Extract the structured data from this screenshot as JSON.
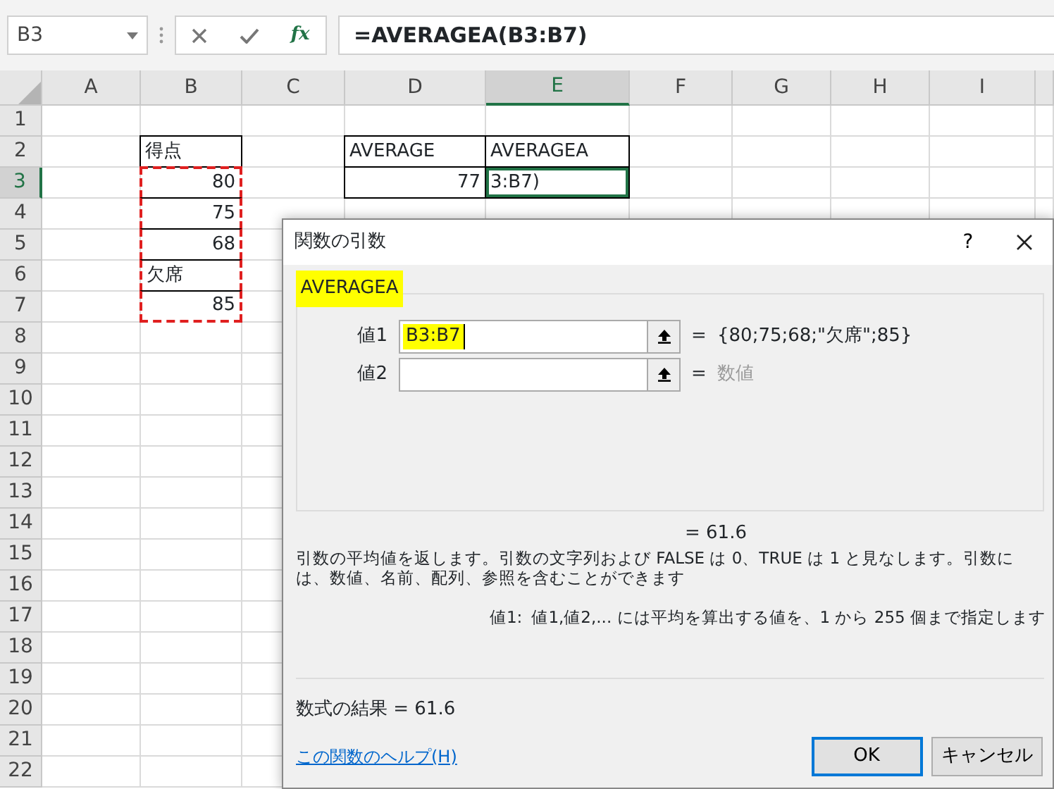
{
  "name_box": {
    "value": "B3"
  },
  "formula_bar": {
    "function_button": "fx",
    "formula": "=AVERAGEA(B3:B7)"
  },
  "sheet": {
    "columns": [
      {
        "label": "A",
        "selected": false
      },
      {
        "label": "B",
        "selected": false
      },
      {
        "label": "C",
        "selected": false
      },
      {
        "label": "D",
        "selected": false
      },
      {
        "label": "E",
        "selected": true
      },
      {
        "label": "F",
        "selected": false
      },
      {
        "label": "G",
        "selected": false
      },
      {
        "label": "H",
        "selected": false
      },
      {
        "label": "I",
        "selected": false
      }
    ],
    "rows": [
      {
        "label": "1",
        "selected": false
      },
      {
        "label": "2",
        "selected": false,
        "cells": [
          null,
          {
            "kind": "text",
            "text": "得点",
            "bordered": true,
            "marquee": false
          },
          null,
          {
            "kind": "text",
            "text": "AVERAGE",
            "bordered": true,
            "marquee": false
          },
          {
            "kind": "text",
            "text": "AVERAGEA",
            "bordered": true,
            "marquee": false
          }
        ]
      },
      {
        "label": "3",
        "selected": true,
        "cells": [
          null,
          {
            "kind": "number",
            "text": "80",
            "bordered": true,
            "marquee": true
          },
          null,
          {
            "kind": "number",
            "text": "77",
            "bordered": true,
            "marquee": false
          },
          {
            "kind": "text",
            "text": "3:B7)",
            "bordered": true,
            "marquee": false
          }
        ]
      },
      {
        "label": "4",
        "selected": false,
        "cells": [
          null,
          {
            "kind": "number",
            "text": "75",
            "bordered": true,
            "marquee": true
          }
        ]
      },
      {
        "label": "5",
        "selected": false,
        "cells": [
          null,
          {
            "kind": "number",
            "text": "68",
            "bordered": true,
            "marquee": true
          }
        ]
      },
      {
        "label": "6",
        "selected": false,
        "cells": [
          null,
          {
            "kind": "text",
            "text": "欠席",
            "bordered": true,
            "marquee": true
          }
        ]
      },
      {
        "label": "7",
        "selected": false,
        "cells": [
          null,
          {
            "kind": "number",
            "text": "85",
            "bordered": true,
            "marquee": true
          }
        ]
      },
      {
        "label": "8",
        "selected": false
      },
      {
        "label": "9",
        "selected": false
      },
      {
        "label": "10",
        "selected": false
      },
      {
        "label": "11",
        "selected": false
      },
      {
        "label": "12",
        "selected": false
      },
      {
        "label": "13",
        "selected": false
      },
      {
        "label": "14",
        "selected": false
      },
      {
        "label": "15",
        "selected": false
      },
      {
        "label": "16",
        "selected": false
      },
      {
        "label": "17",
        "selected": false
      },
      {
        "label": "18",
        "selected": false
      },
      {
        "label": "19",
        "selected": false
      },
      {
        "label": "20",
        "selected": false
      },
      {
        "label": "21",
        "selected": false
      },
      {
        "label": "22",
        "selected": false
      }
    ]
  },
  "dialog": {
    "title": "関数の引数",
    "help_button": "?",
    "function_name": "AVERAGEA",
    "arguments": [
      {
        "label": "値1",
        "value": "B3:B7",
        "highlighted": true,
        "equals": "=",
        "result": "{80;75;68;\"欠席\";85}",
        "result_muted": false
      },
      {
        "label": "値2",
        "equals": "=",
        "result": "数値",
        "result_muted": true
      }
    ],
    "current_result": "=  61.6",
    "description": "引数の平均値を返します。引数の文字列および FALSE は 0、TRUE は 1 と見なします。引数には、数値、名前、配列、参照を含むことができます",
    "argument_help": {
      "label": "値1:",
      "text": "値1,値2,... には平均を算出する値を、1 から 255 個まで指定します"
    },
    "formula_result": "数式の結果 =  61.6",
    "help_link": "この関数のヘルプ(H)",
    "buttons": [
      {
        "label": "OK",
        "default": true
      },
      {
        "label": "キャンセル",
        "default": false
      }
    ]
  }
}
